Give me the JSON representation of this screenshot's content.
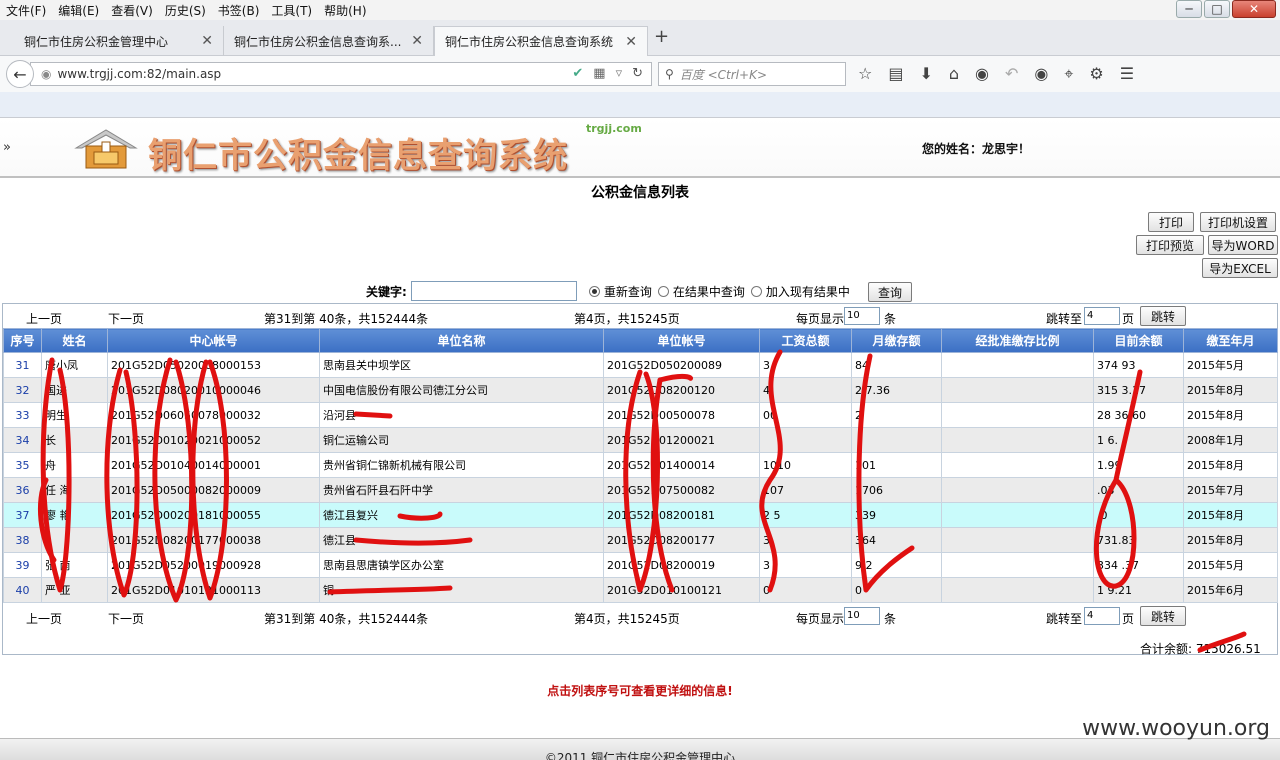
{
  "menubar": [
    "文件(F)",
    "编辑(E)",
    "查看(V)",
    "历史(S)",
    "书签(B)",
    "工具(T)",
    "帮助(H)"
  ],
  "tabs": [
    {
      "label": "铜仁市住房公积金管理中心"
    },
    {
      "label": "铜仁市住房公积金信息查询系..."
    },
    {
      "label": "铜仁市住房公积金信息查询系统"
    }
  ],
  "address": {
    "url": "www.trgjj.com:82/main.asp"
  },
  "search": {
    "placeholder": "百度 <Ctrl+K>"
  },
  "header": {
    "logo_text": "铜仁市公积金信息查询系统",
    "logo_domain": "trgjj.com",
    "user": "您的姓名：龙思宇！",
    "collapse": "»"
  },
  "page": {
    "title": "公积金信息列表"
  },
  "buttons": {
    "print": "打印",
    "printer_setup": "打印机设置",
    "print_preview": "打印预览",
    "export_word": "导为WORD",
    "export_excel": "导为EXCEL",
    "query": "查询",
    "jump": "跳转"
  },
  "searchbar": {
    "keyword_label": "关键字:",
    "options": [
      "重新查询",
      "在结果中查询",
      "加入现有结果中"
    ],
    "selected": 0
  },
  "pager": {
    "prev": "上一页",
    "next": "下一页",
    "range": "第31到第 40条，共152444条",
    "page_info": "第4页，共15245页",
    "per_page_label": "每页显示",
    "per_page": "10",
    "per_page_unit": "条",
    "jump_label": "跳转至",
    "jump_to": "4",
    "jump_unit": "页"
  },
  "table": {
    "headers": [
      "序号",
      "姓名",
      "中心帐号",
      "单位名称",
      "单位帐号",
      "工资总额",
      "月缴存额",
      "经批准缴存比例",
      "目前余额",
      "缴至年月"
    ],
    "rows": [
      {
        "seq": "31",
        "name": "唐小凤",
        "acct": "201G52D05020008000153",
        "unit": "思南县关中坝学区",
        "unit_acct": "201G52D050200089",
        "salary": "3",
        "monthly": "84",
        "ratio": "",
        "balance": "374  93",
        "paid_to": "2015年5月"
      },
      {
        "seq": "32",
        "name": "  国进",
        "acct": "201G52D08020010000046",
        "unit": "中国电信股份有限公司德江分公司",
        "unit_acct": "201G52D08200120",
        "salary": "  4",
        "monthly": "2  7.36",
        "ratio": "",
        "balance": "315  3.17",
        "paid_to": "2015年8月"
      },
      {
        "seq": "33",
        "name": "  明生",
        "acct": "201G52D06050078000032",
        "unit": "沿河县",
        "unit_acct": "201G52D00500078",
        "salary": "  00",
        "monthly": "  2",
        "ratio": "",
        "balance": "28  36.60",
        "paid_to": "2015年8月"
      },
      {
        "seq": "34",
        "name": "  长",
        "acct": "201G52D01020021000052",
        "unit": "铜仁运输公司",
        "unit_acct": "201G52D01200021",
        "salary": "",
        "monthly": "",
        "ratio": "",
        "balance": "1  6.",
        "paid_to": "2008年1月"
      },
      {
        "seq": "35",
        "name": "  舟",
        "acct": "201G52D01040014000001",
        "unit": "贵州省铜仁锦新机械有限公司",
        "unit_acct": "201G52D01400014",
        "salary": "1010",
        "monthly": "101",
        "ratio": "",
        "balance": "  1.99",
        "paid_to": "2015年8月"
      },
      {
        "seq": "36",
        "name": "任  海",
        "acct": "201G52D05000082000009",
        "unit": "贵州省石阡县石阡中学",
        "unit_acct": "201G52D07500082",
        "salary": "  107",
        "monthly": "1706",
        "ratio": "",
        "balance": "  .03",
        "paid_to": "2015年7月"
      },
      {
        "seq": "37",
        "name": "廖  艳",
        "acct": "201G52D00200181000055",
        "unit": "德江县复兴",
        "unit_acct": "201G52D08200181",
        "salary": "2  5",
        "monthly": "339",
        "ratio": "",
        "balance": "  .0",
        "paid_to": "2015年8月"
      },
      {
        "seq": "38",
        "name": "  ",
        "acct": "201G52D08200177000038",
        "unit": "德江县",
        "unit_acct": "201G52D08200177",
        "salary": "  3",
        "monthly": "364",
        "ratio": "",
        "balance": "  731.83",
        "paid_to": "2015年8月"
      },
      {
        "seq": "39",
        "name": "张  南",
        "acct": "201G52D05200019000928",
        "unit": "思南县思唐镇学区办公室",
        "unit_acct": "201G52D08200019",
        "salary": "  3",
        "monthly": "9  2",
        "ratio": "",
        "balance": "334  .37",
        "paid_to": "2015年5月"
      },
      {
        "seq": "40",
        "name": "严  亚",
        "acct": "201G52D01010121000113",
        "unit": "铜",
        "unit_acct": "201G52D010100121",
        "salary": "0",
        "monthly": "0",
        "ratio": "",
        "balance": "1  9.21",
        "paid_to": "2015年6月"
      }
    ]
  },
  "total": {
    "label": "合计余额:",
    "value": "  715026.51"
  },
  "notice": "点击列表序号可查看更详细的信息!",
  "footer": "©2011 铜仁市住房公积金管理中心",
  "watermark": "www.wooyun.org",
  "colors": {
    "header_blue": "#3b6fc4",
    "highlight_row": "#c9fbfb",
    "notice_red": "#c01010",
    "scribble": "#e01010"
  }
}
